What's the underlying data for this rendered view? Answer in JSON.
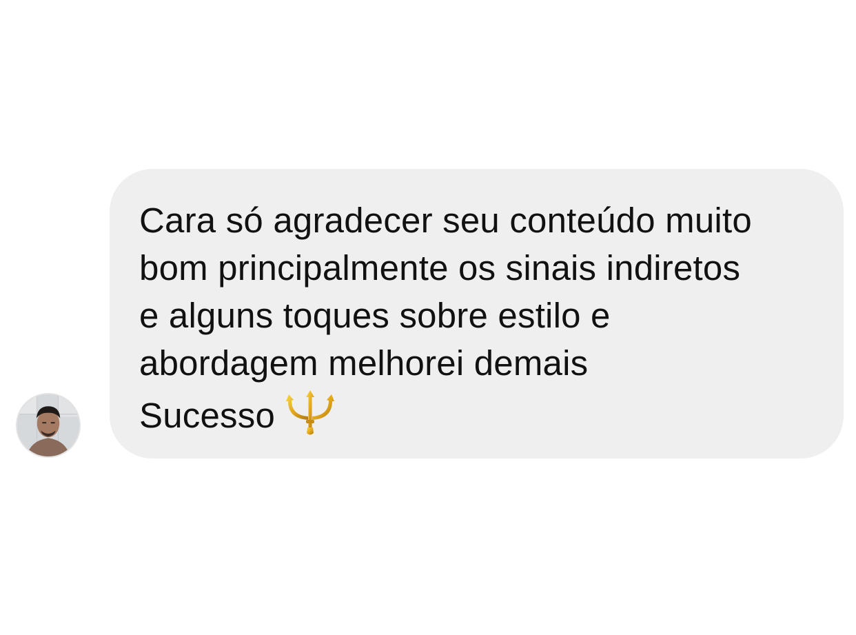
{
  "chat": {
    "sender": {
      "avatar_icon": "user-avatar-photo"
    },
    "message": {
      "lines": [
        "Cara só agradecer seu conteúdo muito",
        "bom principalmente os sinais indiretos",
        "e alguns toques sobre estilo e",
        "abordagem melhorei demais"
      ],
      "closing": "Sucesso",
      "emoji_icon": "trident-emoji",
      "bubble_color": "#efefef",
      "text_color": "#111111"
    }
  }
}
